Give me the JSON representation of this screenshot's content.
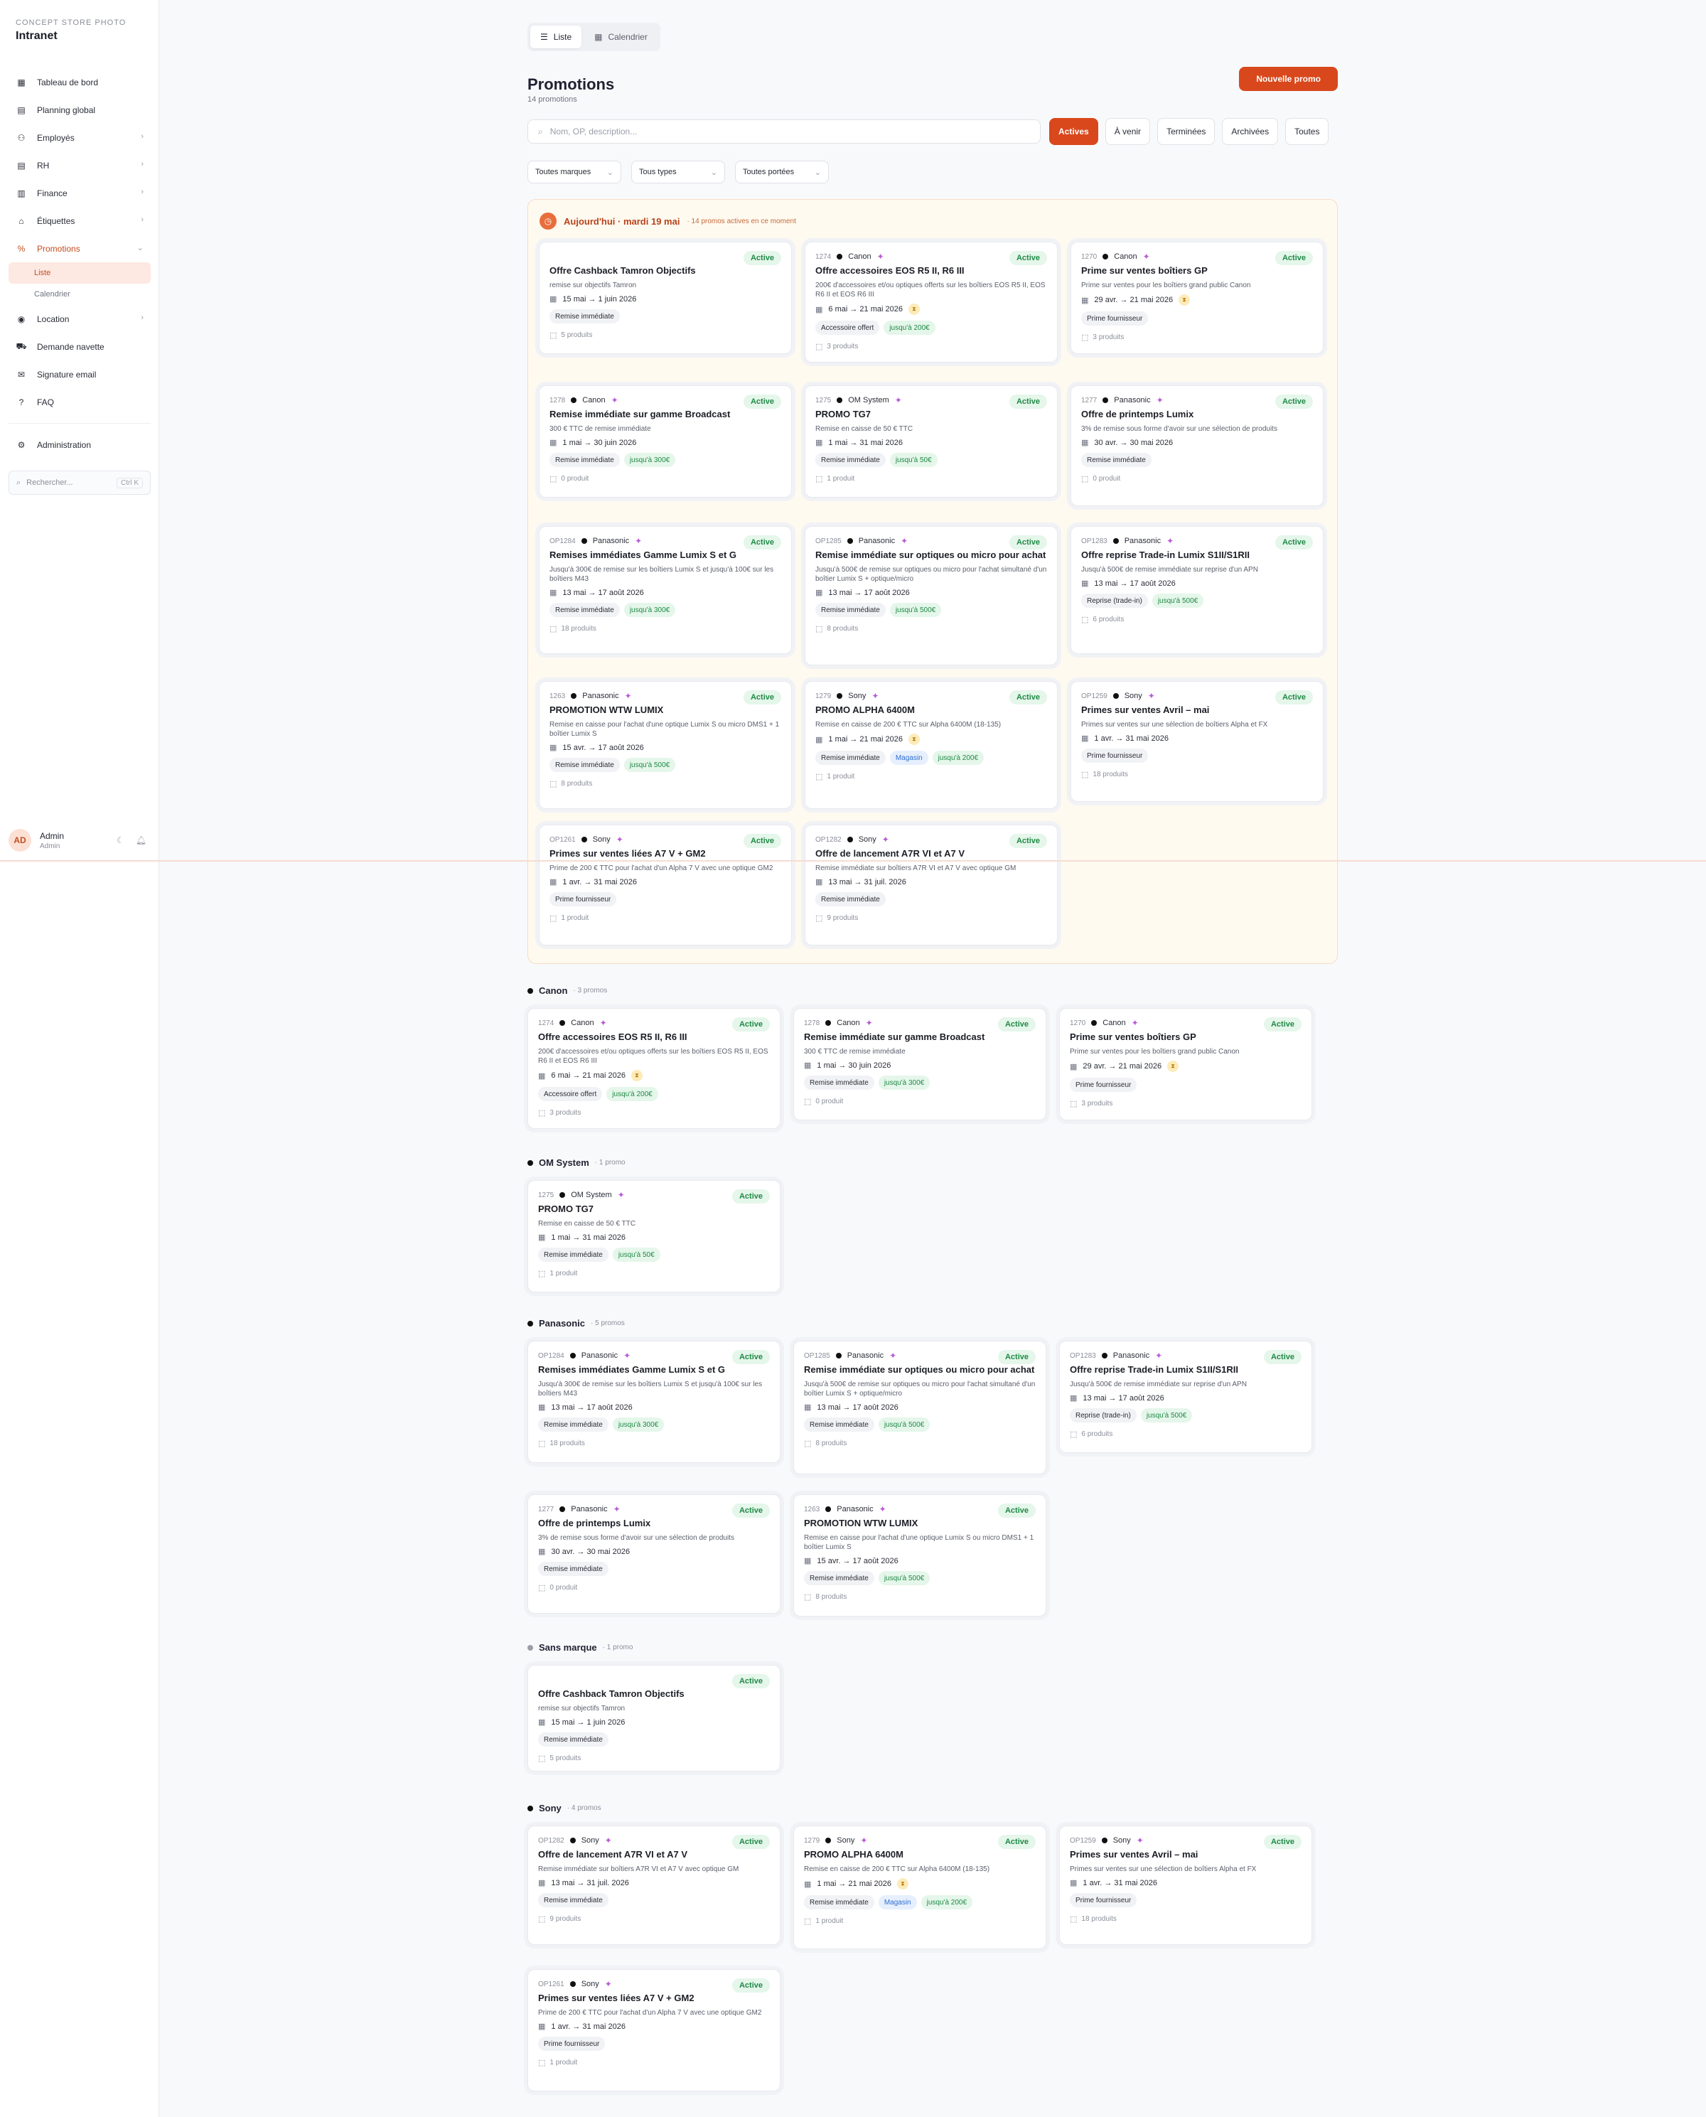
{
  "brand": {
    "subtitle": "CONCEPT STORE PHOTO",
    "title": "Intranet"
  },
  "sidebar": {
    "items": [
      {
        "label": "Tableau de bord",
        "icon": "grid-icon",
        "chevron": false
      },
      {
        "label": "Planning global",
        "icon": "calendar-icon",
        "chevron": false
      },
      {
        "label": "Employés",
        "icon": "users-icon",
        "chevron": true
      },
      {
        "label": "RH",
        "icon": "calendar-icon",
        "chevron": true
      },
      {
        "label": "Finance",
        "icon": "chart-icon",
        "chevron": true
      },
      {
        "label": "Étiquettes",
        "icon": "tag-icon",
        "chevron": true
      },
      {
        "label": "Promotions",
        "icon": "percent-icon",
        "chevron": true,
        "active": true
      }
    ],
    "sub_items": [
      {
        "label": "Liste",
        "active": true
      },
      {
        "label": "Calendrier"
      }
    ],
    "items2": [
      {
        "label": "Location",
        "icon": "camera-icon",
        "chevron": true
      },
      {
        "label": "Demande navette",
        "icon": "truck-icon",
        "chevron": false
      },
      {
        "label": "Signature email",
        "icon": "mail-icon",
        "chevron": false
      },
      {
        "label": "FAQ",
        "icon": "help-icon",
        "chevron": false
      }
    ],
    "admin": {
      "label": "Administration",
      "icon": "gear-icon"
    },
    "search": {
      "placeholder": "Rechercher...",
      "shortcut": "Ctrl K"
    },
    "user": {
      "initials": "AD",
      "name": "Admin",
      "role": "Admin"
    }
  },
  "header": {
    "view_tabs": [
      {
        "label": "Liste",
        "icon": "list-icon",
        "active": true
      },
      {
        "label": "Calendrier",
        "icon": "calendar-icon"
      }
    ],
    "title": "Promotions",
    "count": "14 promotions",
    "new_button": "Nouvelle promo",
    "search_placeholder": "Nom, OP, description...",
    "status_tabs": [
      {
        "label": "Actives",
        "active": true
      },
      {
        "label": "À venir"
      },
      {
        "label": "Terminées"
      },
      {
        "label": "Archivées"
      },
      {
        "label": "Toutes"
      }
    ],
    "filters": [
      "Toutes marques",
      "Tous types",
      "Toutes portées"
    ]
  },
  "today": {
    "title": "Aujourd'hui · mardi 19 mai",
    "sub": "· 14 promos actives en ce moment"
  },
  "promos": {
    "tamron": {
      "op": "",
      "brand": "",
      "title": "Offre Cashback Tamron Objectifs",
      "desc": "remise sur objectifs Tamron",
      "dates": "15 mai → 1 juin 2026",
      "ending": false,
      "tags": [
        {
          "t": "Remise immédiate"
        }
      ],
      "products": "5 produits"
    },
    "1274": {
      "op": "1274",
      "brand": "Canon",
      "title": "Offre accessoires EOS R5 II, R6 III",
      "desc": "200€ d'accessoires et/ou optiques offerts sur les boîtiers EOS R5 II, EOS R6 II et EOS R6 III",
      "dates": "6 mai → 21 mai 2026",
      "ending": true,
      "tags": [
        {
          "t": "Accessoire offert"
        },
        {
          "t": "jusqu'à 200€",
          "c": "green"
        }
      ],
      "products": "3 produits"
    },
    "1270": {
      "op": "1270",
      "brand": "Canon",
      "title": "Prime sur ventes boîtiers GP",
      "desc": "Prime sur ventes pour les boîtiers grand public Canon",
      "dates": "29 avr. → 21 mai 2026",
      "ending": true,
      "tags": [
        {
          "t": "Prime fournisseur"
        }
      ],
      "products": "3 produits"
    },
    "1278": {
      "op": "1278",
      "brand": "Canon",
      "title": "Remise immédiate sur gamme Broadcast",
      "desc": "300 € TTC de remise immédiate",
      "dates": "1 mai → 30 juin 2026",
      "ending": false,
      "tags": [
        {
          "t": "Remise immédiate"
        },
        {
          "t": "jusqu'à 300€",
          "c": "green"
        }
      ],
      "products": "0 produit"
    },
    "1275": {
      "op": "1275",
      "brand": "OM System",
      "title": "PROMO TG7",
      "desc": "Remise en caisse de 50 € TTC",
      "dates": "1 mai → 31 mai 2026",
      "ending": false,
      "tags": [
        {
          "t": "Remise immédiate"
        },
        {
          "t": "jusqu'à 50€",
          "c": "green"
        }
      ],
      "products": "1 produit"
    },
    "1277": {
      "op": "1277",
      "brand": "Panasonic",
      "title": "Offre de printemps Lumix",
      "desc": "3% de remise sous forme d'avoir sur une sélection de produits",
      "dates": "30 avr. → 30 mai 2026",
      "ending": false,
      "tags": [
        {
          "t": "Remise immédiate"
        }
      ],
      "products": "0 produit"
    },
    "op1284": {
      "op": "OP1284",
      "brand": "Panasonic",
      "title": "Remises immédiates Gamme Lumix S et G",
      "desc": "Jusqu'à 300€ de remise sur les boîtiers Lumix S et jusqu'à 100€ sur les boîtiers M43",
      "dates": "13 mai → 17 août 2026",
      "ending": false,
      "tags": [
        {
          "t": "Remise immédiate"
        },
        {
          "t": "jusqu'à 300€",
          "c": "green"
        }
      ],
      "products": "18 produits"
    },
    "op1285": {
      "op": "OP1285",
      "brand": "Panasonic",
      "title": "Remise immédiate sur optiques ou micro pour achat Lumix S + optique/micro",
      "desc": "Jusqu'à 500€ de remise sur optiques ou micro pour l'achat simultané d'un boîtier Lumix S + optique/micro",
      "dates": "13 mai → 17 août 2026",
      "ending": false,
      "tags": [
        {
          "t": "Remise immédiate"
        },
        {
          "t": "jusqu'à 500€",
          "c": "green"
        }
      ],
      "products": "8 produits"
    },
    "op1283": {
      "op": "OP1283",
      "brand": "Panasonic",
      "title": "Offre reprise Trade-in Lumix S1II/S1RII",
      "desc": "Jusqu'à 500€ de remise immédiate sur reprise d'un APN",
      "dates": "13 mai → 17 août 2026",
      "ending": false,
      "tags": [
        {
          "t": "Reprise (trade-in)"
        },
        {
          "t": "jusqu'à 500€",
          "c": "green"
        }
      ],
      "products": "6 produits"
    },
    "1263": {
      "op": "1263",
      "brand": "Panasonic",
      "title": "PROMOTION WTW LUMIX",
      "desc": "Remise en caisse pour l'achat d'une optique Lumix S ou micro DMS1 + 1 boîtier Lumix S",
      "dates": "15 avr. → 17 août 2026",
      "ending": false,
      "tags": [
        {
          "t": "Remise immédiate"
        },
        {
          "t": "jusqu'à 500€",
          "c": "green"
        }
      ],
      "products": "8 produits"
    },
    "1279": {
      "op": "1279",
      "brand": "Sony",
      "title": "PROMO ALPHA 6400M",
      "desc": "Remise en caisse de 200 € TTC sur Alpha 6400M (18-135)",
      "dates": "1 mai → 21 mai 2026",
      "ending": true,
      "tags": [
        {
          "t": "Remise immédiate"
        },
        {
          "t": "Magasin",
          "c": "blue"
        },
        {
          "t": "jusqu'à 200€",
          "c": "green"
        }
      ],
      "products": "1 produit"
    },
    "op1259": {
      "op": "OP1259",
      "brand": "Sony",
      "title": "Primes sur ventes Avril – mai",
      "desc": "Primes sur ventes sur une sélection de boîtiers Alpha et FX",
      "dates": "1 avr. → 31 mai 2026",
      "ending": false,
      "tags": [
        {
          "t": "Prime fournisseur"
        }
      ],
      "products": "18 produits"
    },
    "op1261": {
      "op": "OP1261",
      "brand": "Sony",
      "title": "Primes sur ventes liées A7 V + GM2",
      "desc": "Prime de 200 € TTC pour l'achat d'un Alpha 7 V avec une optique GM2",
      "dates": "1 avr. → 31 mai 2026",
      "ending": false,
      "tags": [
        {
          "t": "Prime fournisseur"
        }
      ],
      "products": "1 produit"
    },
    "op1282": {
      "op": "OP1282",
      "brand": "Sony",
      "title": "Offre de lancement A7R VI et A7 V",
      "desc": "Remise immédiate sur boîtiers A7R VI et A7 V avec optique GM",
      "dates": "13 mai → 31 juil. 2026",
      "ending": false,
      "tags": [
        {
          "t": "Remise immédiate"
        }
      ],
      "products": "9 produits"
    }
  },
  "status_label": "Active",
  "groups": [
    {
      "key": "canon",
      "name": "Canon",
      "count": "· 3 promos"
    },
    {
      "key": "om",
      "name": "OM System",
      "count": "· 1 promo"
    },
    {
      "key": "panasonic",
      "name": "Panasonic",
      "count": "· 5 promos"
    },
    {
      "key": "none",
      "name": "Sans marque",
      "count": "· 1 promo"
    },
    {
      "key": "sony",
      "name": "Sony",
      "count": "· 4 promos"
    }
  ]
}
